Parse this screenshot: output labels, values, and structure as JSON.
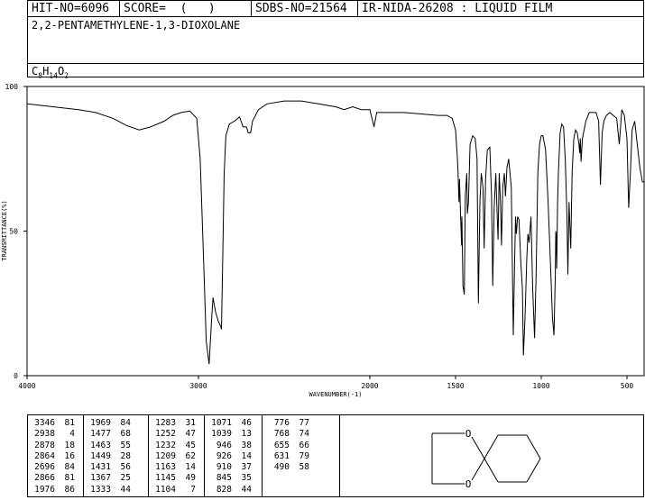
{
  "header": {
    "hit_no": "HIT-NO=6096",
    "score": "SCORE=  (   )",
    "sdbs_no": "SDBS-NO=21564",
    "ir_info": "IR-NIDA-26208 : LIQUID FILM",
    "compound_name": "2,2-PENTAMETHYLENE-1,3-DIOXOLANE",
    "formula": {
      "C": "C",
      "c_n": "8",
      "H": "H",
      "h_n": "14",
      "O": "O",
      "o_n": "2"
    }
  },
  "chart_data": {
    "type": "line",
    "title": "",
    "xlabel": "WAVENUMBER(-1)",
    "ylabel": "TRANSMITTANCE(%)",
    "xlim": [
      4000,
      400
    ],
    "ylim": [
      0,
      100
    ],
    "x_ticks": [
      4000,
      3000,
      2000,
      1500,
      1000,
      500
    ],
    "y_ticks": [
      0,
      50,
      100
    ],
    "grid": false,
    "series": [
      {
        "name": "",
        "color": "#000000",
        "points": [
          [
            4000,
            94
          ],
          [
            3850,
            93
          ],
          [
            3700,
            92
          ],
          [
            3600,
            91
          ],
          [
            3500,
            89
          ],
          [
            3420,
            86.5
          ],
          [
            3346,
            85
          ],
          [
            3280,
            86
          ],
          [
            3200,
            88
          ],
          [
            3150,
            90
          ],
          [
            3100,
            91
          ],
          [
            3050,
            91.5
          ],
          [
            3010,
            89
          ],
          [
            2990,
            75
          ],
          [
            2970,
            40
          ],
          [
            2955,
            12
          ],
          [
            2938,
            4
          ],
          [
            2925,
            18
          ],
          [
            2915,
            27
          ],
          [
            2900,
            22
          ],
          [
            2885,
            19
          ],
          [
            2878,
            18
          ],
          [
            2870,
            17
          ],
          [
            2866,
            16
          ],
          [
            2860,
            35
          ],
          [
            2850,
            70
          ],
          [
            2840,
            83
          ],
          [
            2820,
            87
          ],
          [
            2790,
            88
          ],
          [
            2760,
            89.5
          ],
          [
            2740,
            86
          ],
          [
            2720,
            86
          ],
          [
            2710,
            84
          ],
          [
            2696,
            84
          ],
          [
            2685,
            88
          ],
          [
            2650,
            92
          ],
          [
            2600,
            94
          ],
          [
            2500,
            95
          ],
          [
            2400,
            95
          ],
          [
            2300,
            94
          ],
          [
            2200,
            93
          ],
          [
            2150,
            92
          ],
          [
            2100,
            93
          ],
          [
            2050,
            92
          ],
          [
            2000,
            92
          ],
          [
            1976,
            86
          ],
          [
            1960,
            91
          ],
          [
            1900,
            91
          ],
          [
            1800,
            91
          ],
          [
            1700,
            90.5
          ],
          [
            1600,
            90
          ],
          [
            1550,
            90
          ],
          [
            1520,
            89
          ],
          [
            1500,
            85
          ],
          [
            1490,
            76
          ],
          [
            1485,
            70
          ],
          [
            1480,
            60
          ],
          [
            1477,
            68
          ],
          [
            1472,
            58
          ],
          [
            1465,
            45
          ],
          [
            1463,
            55
          ],
          [
            1457,
            31
          ],
          [
            1449,
            28
          ],
          [
            1443,
            62
          ],
          [
            1435,
            70
          ],
          [
            1431,
            56
          ],
          [
            1425,
            60
          ],
          [
            1415,
            80
          ],
          [
            1400,
            83
          ],
          [
            1385,
            82
          ],
          [
            1375,
            75
          ],
          [
            1367,
            25
          ],
          [
            1358,
            60
          ],
          [
            1350,
            70
          ],
          [
            1340,
            65
          ],
          [
            1333,
            44
          ],
          [
            1325,
            68
          ],
          [
            1315,
            78
          ],
          [
            1300,
            79
          ],
          [
            1290,
            62
          ],
          [
            1283,
            31
          ],
          [
            1275,
            58
          ],
          [
            1265,
            70
          ],
          [
            1252,
            47
          ],
          [
            1245,
            70
          ],
          [
            1238,
            60
          ],
          [
            1232,
            45
          ],
          [
            1225,
            65
          ],
          [
            1215,
            70
          ],
          [
            1209,
            62
          ],
          [
            1200,
            72
          ],
          [
            1190,
            75
          ],
          [
            1175,
            65
          ],
          [
            1163,
            14
          ],
          [
            1155,
            40
          ],
          [
            1150,
            55
          ],
          [
            1145,
            49
          ],
          [
            1138,
            55
          ],
          [
            1130,
            54
          ],
          [
            1120,
            40
          ],
          [
            1110,
            30
          ],
          [
            1104,
            7
          ],
          [
            1095,
            20
          ],
          [
            1085,
            40
          ],
          [
            1078,
            49
          ],
          [
            1071,
            46
          ],
          [
            1060,
            55
          ],
          [
            1050,
            30
          ],
          [
            1039,
            13
          ],
          [
            1030,
            35
          ],
          [
            1020,
            70
          ],
          [
            1010,
            80
          ],
          [
            1000,
            83
          ],
          [
            990,
            83
          ],
          [
            975,
            78
          ],
          [
            960,
            60
          ],
          [
            946,
            38
          ],
          [
            935,
            20
          ],
          [
            926,
            14
          ],
          [
            918,
            35
          ],
          [
            915,
            50
          ],
          [
            912,
            48
          ],
          [
            910,
            37
          ],
          [
            905,
            60
          ],
          [
            900,
            70
          ],
          [
            890,
            84
          ],
          [
            880,
            87
          ],
          [
            870,
            86
          ],
          [
            860,
            75
          ],
          [
            850,
            55
          ],
          [
            845,
            35
          ],
          [
            838,
            60
          ],
          [
            828,
            44
          ],
          [
            820,
            70
          ],
          [
            810,
            82
          ],
          [
            800,
            85
          ],
          [
            790,
            84
          ],
          [
            780,
            80
          ],
          [
            776,
            77
          ],
          [
            772,
            82
          ],
          [
            768,
            74
          ],
          [
            760,
            82
          ],
          [
            740,
            88
          ],
          [
            720,
            91
          ],
          [
            700,
            91
          ],
          [
            680,
            91
          ],
          [
            665,
            88
          ],
          [
            655,
            66
          ],
          [
            645,
            84
          ],
          [
            635,
            88
          ],
          [
            620,
            90
          ],
          [
            600,
            91
          ],
          [
            580,
            90
          ],
          [
            560,
            89
          ],
          [
            545,
            80
          ],
          [
            530,
            92
          ],
          [
            515,
            90
          ],
          [
            500,
            82
          ],
          [
            490,
            58
          ],
          [
            480,
            70
          ],
          [
            470,
            85
          ],
          [
            455,
            88
          ],
          [
            440,
            80
          ],
          [
            425,
            72
          ],
          [
            410,
            67
          ],
          [
            400,
            67
          ]
        ]
      }
    ]
  },
  "peaks": {
    "columns": [
      [
        [
          "3346",
          "81"
        ],
        [
          "2938",
          "4"
        ],
        [
          "2878",
          "18"
        ],
        [
          "2864",
          "16"
        ],
        [
          "2696",
          "84"
        ],
        [
          "2866",
          "81"
        ],
        [
          "1976",
          "86"
        ]
      ],
      [
        [
          "1969",
          "84"
        ],
        [
          "1477",
          "68"
        ],
        [
          "1463",
          "55"
        ],
        [
          "1449",
          "28"
        ],
        [
          "1431",
          "56"
        ],
        [
          "1367",
          "25"
        ],
        [
          "1333",
          "44"
        ]
      ],
      [
        [
          "1283",
          "31"
        ],
        [
          "1252",
          "47"
        ],
        [
          "1232",
          "45"
        ],
        [
          "1209",
          "62"
        ],
        [
          "1163",
          "14"
        ],
        [
          "1145",
          "49"
        ],
        [
          "1104",
          "7"
        ]
      ],
      [
        [
          "1071",
          "46"
        ],
        [
          "1039",
          "13"
        ],
        [
          "946",
          "38"
        ],
        [
          "926",
          "14"
        ],
        [
          "910",
          "37"
        ],
        [
          "845",
          "35"
        ],
        [
          "828",
          "44"
        ]
      ],
      [
        [
          "776",
          "77"
        ],
        [
          "768",
          "74"
        ],
        [
          "655",
          "66"
        ],
        [
          "631",
          "79"
        ],
        [
          "490",
          "58"
        ]
      ]
    ]
  },
  "structure": {
    "atom_label_1": "O",
    "atom_label_2": "O"
  }
}
